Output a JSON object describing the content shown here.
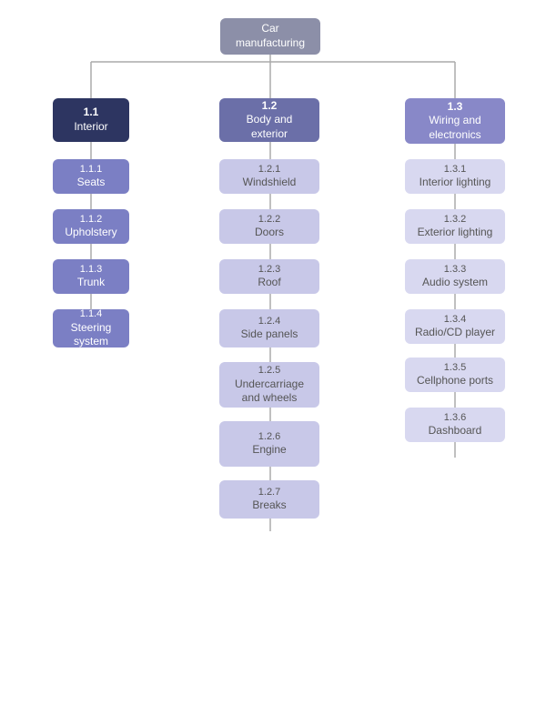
{
  "diagram": {
    "title": "Car manufacturing",
    "columns": [
      {
        "id": "interior",
        "header": {
          "num": "1.1",
          "label": "Interior"
        },
        "items": [
          {
            "num": "1.1.1",
            "label": "Seats"
          },
          {
            "num": "1.1.2",
            "label": "Upholstery"
          },
          {
            "num": "1.1.3",
            "label": "Trunk"
          },
          {
            "num": "1.1.4",
            "label": "Steering system"
          }
        ]
      },
      {
        "id": "body",
        "header": {
          "num": "1.2",
          "label": "Body and exterior"
        },
        "items": [
          {
            "num": "1.2.1",
            "label": "Windshield"
          },
          {
            "num": "1.2.2",
            "label": "Doors"
          },
          {
            "num": "1.2.3",
            "label": "Roof"
          },
          {
            "num": "1.2.4",
            "label": "Side panels"
          },
          {
            "num": "1.2.5",
            "label": "Undercarriage and wheels"
          },
          {
            "num": "1.2.6",
            "label": "Engine"
          },
          {
            "num": "1.2.7",
            "label": "Breaks"
          }
        ]
      },
      {
        "id": "wiring",
        "header": {
          "num": "1.3",
          "label": "Wiring and electronics"
        },
        "items": [
          {
            "num": "1.3.1",
            "label": "Interior lighting"
          },
          {
            "num": "1.3.2",
            "label": "Exterior lighting"
          },
          {
            "num": "1.3.3",
            "label": "Audio system"
          },
          {
            "num": "1.3.4",
            "label": "Radio/CD player"
          },
          {
            "num": "1.3.5",
            "label": "Cellphone ports"
          },
          {
            "num": "1.3.6",
            "label": "Dashboard"
          }
        ]
      }
    ]
  }
}
